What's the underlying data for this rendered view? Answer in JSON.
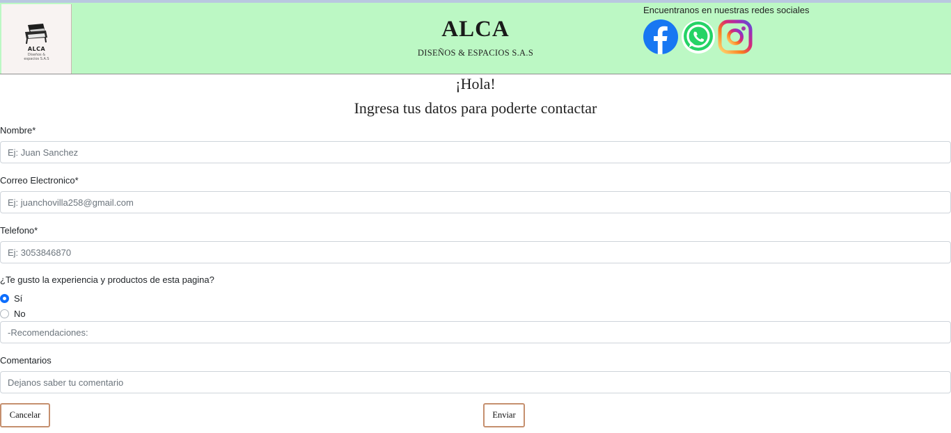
{
  "header": {
    "logo": {
      "name": "ALCA",
      "sub_line1": "Diseños &",
      "sub_line2": "espacios S.A.S"
    },
    "brand_title": "ALCA",
    "brand_subtitle": "DISEÑOS & ESPACIOS S.A.S",
    "social": {
      "title": "Encuentranos en nuestras redes sociales",
      "icons": [
        "facebook-icon",
        "whatsapp-icon",
        "instagram-icon"
      ]
    }
  },
  "greeting": "¡Hola!",
  "subgreeting": "Ingresa tus datos para poderte contactar",
  "form": {
    "name_label": "Nombre*",
    "name_placeholder": "Ej: Juan Sanchez",
    "email_label": "Correo Electronico*",
    "email_placeholder": "Ej: juanchovilla258@gmail.com",
    "phone_label": "Telefono*",
    "phone_placeholder": "Ej: 3053846870",
    "experience_question": "¿Te gusto la experiencia y productos de esta pagina?",
    "options": [
      {
        "label": "Sí",
        "checked": true
      },
      {
        "label": "No",
        "checked": false
      }
    ],
    "recommendations_placeholder": "-Recomendaciones:",
    "comments_label": "Comentarios",
    "comments_placeholder": "Dejanos saber tu comentario"
  },
  "buttons": {
    "cancel": "Cancelar",
    "send": "Enviar"
  },
  "colors": {
    "header_bg": "#bcf8c4",
    "facebook": "#1877f2",
    "whatsapp": "#25d366",
    "radio_accent": "#0d6efd",
    "button_border": "#c58f6e"
  }
}
